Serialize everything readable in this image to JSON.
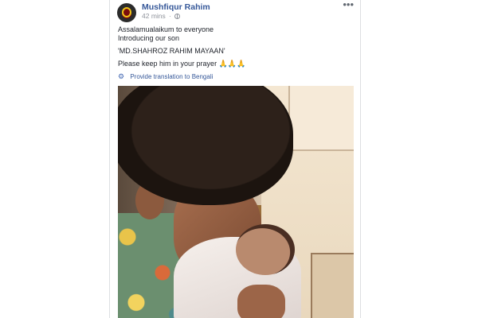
{
  "post": {
    "author": "Mushfiqur Rahim",
    "time": "42 mins",
    "separator": "·",
    "privacy_icon": "globe-icon",
    "options_icon": "more-icon",
    "options_label": "•••",
    "lines": [
      "Assalamualaikum to everyone",
      "Introducing our son",
      "'MD.SHAHROZ RAHIM MAYAAN'",
      "Please keep him in your prayer"
    ],
    "prayer_emoji": "🙏🙏🙏",
    "translate_icon": "gear-icon",
    "translate_glyph": "⚙",
    "translate_label": "Provide translation to Bengali",
    "photo_subject": "post-photo"
  },
  "colors": {
    "link": "#365899",
    "meta": "#90949c",
    "text": "#1d2129",
    "border": "#dddfe2"
  }
}
